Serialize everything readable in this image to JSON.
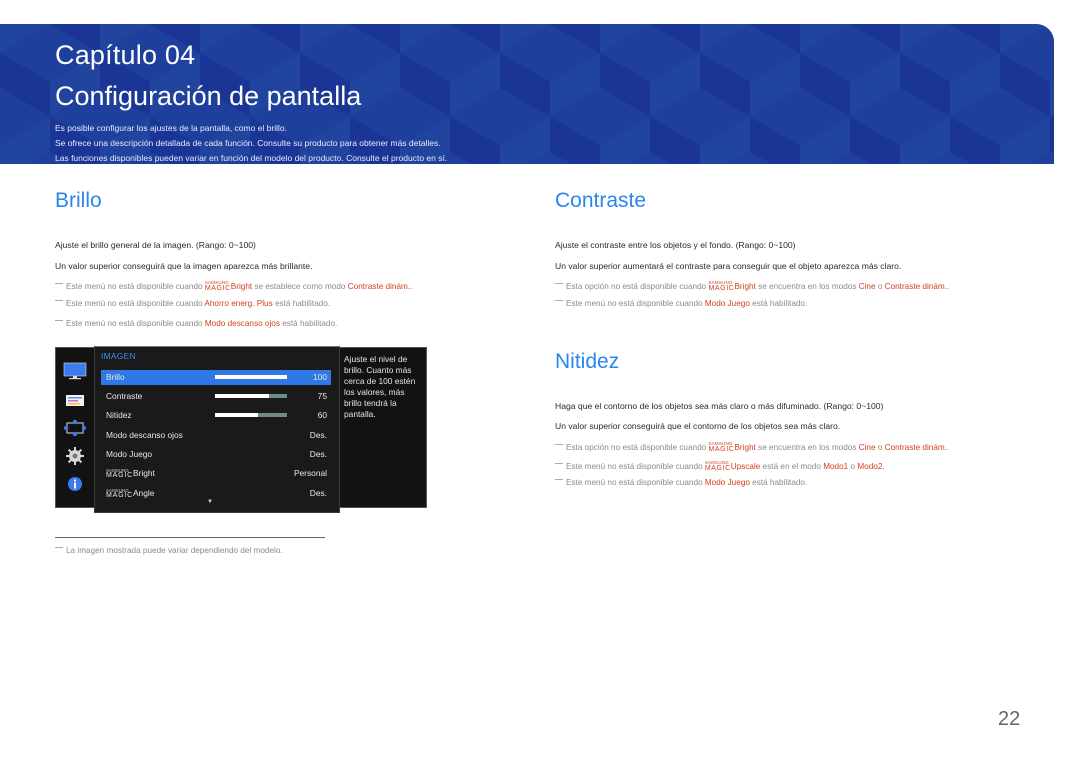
{
  "header": {
    "chapter": "Capítulo 04",
    "title": "Configuración de pantalla",
    "intro": [
      "Es posible configurar los ajustes de la pantalla, como el brillo.",
      "Se ofrece una descripción detallada de cada función. Consulte su producto para obtener más detalles.",
      "Las funciones disponibles pueden variar en función del modelo del producto. Consulte el producto en sí."
    ]
  },
  "brillo": {
    "title": "Brillo",
    "paragraphs": [
      "Ajuste el brillo general de la imagen. (Rango: 0~100)",
      "Un valor superior conseguirá que la imagen aparezca más brillante."
    ],
    "notes": [
      {
        "pre": "Este menú no está disponible cuando ",
        "magic": "Bright",
        "mid": " se establece como modo ",
        "red": "Contraste dinám.",
        "post": "."
      },
      {
        "pre": "Este menú no está disponible cuando ",
        "red": "Ahorro energ. Plus",
        "post": " está habilitado."
      },
      {
        "pre": "Este menú no está disponible cuando ",
        "red": "Modo descanso ojos",
        "post": " está habilitado."
      }
    ]
  },
  "contraste": {
    "title": "Contraste",
    "paragraphs": [
      "Ajuste el contraste entre los objetos y el fondo. (Rango: 0~100)",
      "Un valor superior aumentará el contraste para conseguir que el objeto aparezca más claro."
    ],
    "notes": [
      {
        "pre": "Esta opción no está disponible cuando ",
        "magic": "Bright",
        "mid": " se encuentra en los modos ",
        "red": "Cine",
        "mid2": " o ",
        "red2": "Contraste dinám.",
        "post": "."
      },
      {
        "pre": "Este menú no está disponible cuando ",
        "red": "Modo Juego",
        "post": " está habilitado."
      }
    ]
  },
  "nitidez": {
    "title": "Nitidez",
    "paragraphs": [
      "Haga que el contorno de los objetos sea más claro o más difuminado. (Rango: 0~100)",
      "Un valor superior conseguirá que el contorno de los objetos sea más claro."
    ],
    "notes": [
      {
        "pre": "Esta opción no está disponible cuando ",
        "magic": "Bright",
        "mid": " se encuentra en los modos ",
        "red": "Cine",
        "mid2": " o ",
        "red2": "Contraste dinám.",
        "post": "."
      },
      {
        "pre": "Este menú no está disponible cuando ",
        "magic": "Upscale",
        "mid": " está en el modo ",
        "red": "Modo1",
        "mid2": " o ",
        "red2": "Modo2",
        "post": "."
      },
      {
        "pre": "Este menú no está disponible cuando ",
        "red": "Modo Juego",
        "post": " está habilitado."
      }
    ]
  },
  "magic_brand": {
    "top": "SAMSUNG",
    "bottom": "MAGIC"
  },
  "osd": {
    "header": "IMAGEN",
    "side_icons": [
      "monitor-icon",
      "picture-adjust-icon",
      "position-icon",
      "settings-gear-icon",
      "info-icon"
    ],
    "rows": [
      {
        "label": "Brillo",
        "value": "100",
        "bar": 1.0,
        "selected": true
      },
      {
        "label": "Contraste",
        "value": "75",
        "bar": 0.75
      },
      {
        "label": "Nitidez",
        "value": "60",
        "bar": 0.6
      },
      {
        "label": "Modo descanso ojos",
        "value": "Des."
      },
      {
        "label": "Modo Juego",
        "value": "Des."
      },
      {
        "label": "Bright",
        "magic": true,
        "value": "Personal"
      },
      {
        "label": "Angle",
        "magic": true,
        "value": "Des."
      }
    ],
    "scroll_glyph": "▼",
    "help": "Ajuste el nivel de brillo. Cuanto más cerca de 100 estén los valores, más brillo tendrá la pantalla."
  },
  "footnote": "La imagen mostrada puede variar dependiendo del modelo.",
  "page_number": "22",
  "colors": {
    "banner": "#1d3a9a",
    "accent": "#2a86ef",
    "highlight": "#d23f1e",
    "osd_select": "#2f78e6"
  }
}
